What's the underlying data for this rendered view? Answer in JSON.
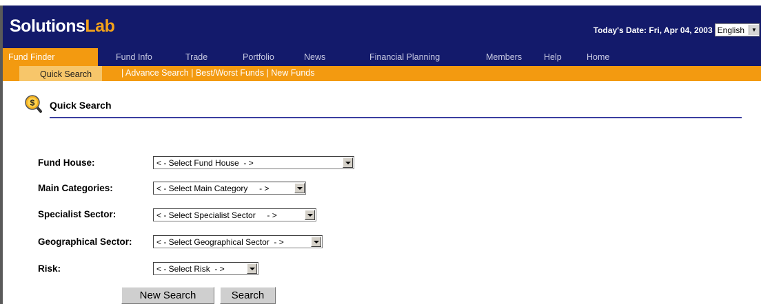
{
  "header": {
    "logo_main": "Solutions",
    "logo_accent": "Lab",
    "date_text": "Today's Date: Fri, Apr 04, 2003",
    "language": "English"
  },
  "nav": {
    "items": [
      "Fund Finder",
      "Fund Info",
      "Trade",
      "Portfolio",
      "News",
      "Financial Planning",
      "Members",
      "Help",
      "Home"
    ],
    "active": "Fund Finder"
  },
  "subnav": {
    "current": "Quick Search",
    "links": [
      "Advance Search",
      "Best/Worst Funds",
      "New Funds"
    ]
  },
  "page": {
    "title": "Quick Search"
  },
  "form": {
    "fields": [
      {
        "label": "Fund House:",
        "value": "< - Select Fund House  - >"
      },
      {
        "label": "Main Categories:",
        "value": "< - Select Main Category     - >"
      },
      {
        "label": "Specialist Sector:",
        "value": "< - Select Specialist Sector     - >"
      },
      {
        "label": "Geographical Sector:",
        "value": "< - Select Geographical Sector  - >"
      },
      {
        "label": "Risk:",
        "value": "< - Select Risk  - >"
      }
    ],
    "new_search_label": "New Search",
    "search_label": "Search"
  },
  "colors": {
    "navy": "#131a6b",
    "orange": "#f39a10",
    "logo_accent": "#f3a21a"
  }
}
